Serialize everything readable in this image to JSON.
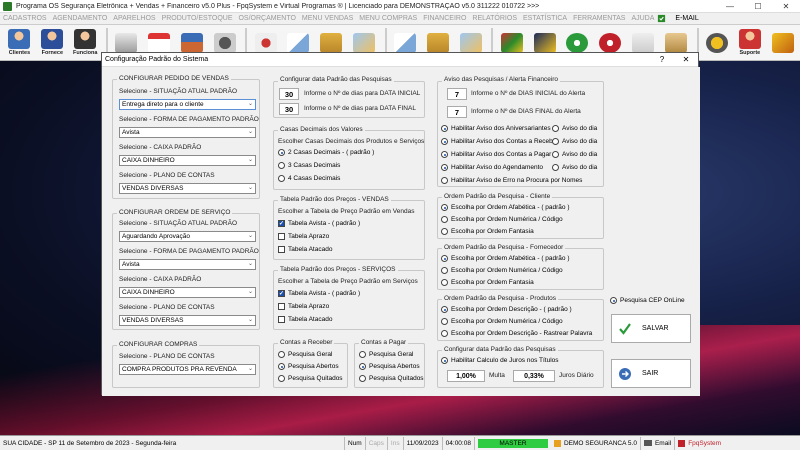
{
  "window": {
    "title": "Programa OS Segurança Eletrônica + Vendas + Financeiro v5.0 Plus - FpqSystem e Virtual Programas ® | Licenciado para  DEMONSTRAÇÃO v5.0 311222 010722 >>>"
  },
  "menu": [
    "CADASTROS",
    "AGENDAMENTO",
    "APARELHOS",
    "PRODUTO/ESTOQUE",
    "OS/ORÇAMENTO",
    "MENU VENDAS",
    "MENU COMPRAS",
    "FINANCEIRO",
    "RELATÓRIOS",
    "ESTATÍSTICA",
    "FERRAMENTAS",
    "AJUDA"
  ],
  "menu_email": "E-MAIL",
  "toolbar": {
    "clientes": "Clientes",
    "fornece": "Fornece",
    "funciona": "Funciona",
    "suporte": "Suporte"
  },
  "dialog": {
    "title": "Configuração Padrão do Sistema",
    "help": "?",
    "close": "✕",
    "pedido": {
      "legend": "CONFIGURAR PEDIDO DE VENDAS",
      "situacao_label": "Selecione - SITUAÇÃO ATUAL PADRÃO",
      "situacao_value": "Entrega direto para o cliente",
      "pagamento_label": "Selecione - FORMA DE PAGAMENTO PADRÃO",
      "pagamento_value": "Avista",
      "caixa_label": "Selecione - CAIXA PADRÃO",
      "caixa_value": "CAIXA DINHEIRO",
      "contas_label": "Selecione - PLANO DE CONTAS",
      "contas_value": "VENDAS DIVERSAS"
    },
    "os": {
      "legend": "CONFIGURAR ORDEM DE SERVIÇO",
      "situacao_label": "Selecione - SITUAÇÃO ATUAL PADRÃO",
      "situacao_value": "Aguardando Aprovação",
      "pagamento_label": "Selecione - FORMA DE PAGAMENTO PADRÃO",
      "pagamento_value": "Avista",
      "caixa_label": "Selecione - CAIXA PADRÃO",
      "caixa_value": "CAIXA DINHEIRO",
      "contas_label": "Selecione - PLANO DE CONTAS",
      "contas_value": "VENDAS DIVERSAS"
    },
    "compras": {
      "legend": "CONFIGURAR COMPRAS",
      "contas_label": "Selecione - PLANO DE CONTAS",
      "contas_value": "COMPRA PRODUTOS PRA REVENDA"
    },
    "data_pesquisa": {
      "legend": "Configurar data Padrão das Pesquisas",
      "inicial_value": "30",
      "inicial_label": "Informe o Nº de dias para DATA INICIAL",
      "final_value": "30",
      "final_label": "Informe o Nº de dias para DATA FINAL"
    },
    "decimais": {
      "legend": "Casas Decimais dos Valores",
      "subtitle": "Escolher Casas Decimais dos Produtos e Serviços",
      "options": [
        "2 Casas Decimais - ( padrão )",
        "3 Casas Decimais",
        "4 Casas Decimais"
      ]
    },
    "preco_vendas": {
      "legend": "Tabela Padrão dos Preços - VENDAS",
      "subtitle": "Escolher a Tabela de Preço Padrão em Vendas",
      "options": [
        "Tabela Avista - ( padrão )",
        "Tabela Aprazo",
        "Tabela Atacado"
      ]
    },
    "preco_servicos": {
      "legend": "Tabela Padrão dos Preços - SERVIÇOS",
      "subtitle": "Escolher a Tabela de Preço Padrão em Serviços",
      "options": [
        "Tabela Avista - ( padrão )",
        "Tabela Aprazo",
        "Tabela Atacado"
      ]
    },
    "receber": {
      "legend": "Contas a Receber",
      "options": [
        "Pesquisa Geral",
        "Pesquisa Abertos",
        "Pesquisa Quitados"
      ]
    },
    "pagar": {
      "legend": "Contas a Pagar",
      "options": [
        "Pesquisa Geral",
        "Pesquisa Abertos",
        "Pesquisa Quitados"
      ]
    },
    "aviso": {
      "legend": "Aviso das Pesquisas / Alerta Financeiro",
      "inicial_value": "7",
      "inicial_label": "Informe o Nº de DIAS INICIAL do Alerta",
      "final_value": "7",
      "final_label": "Informe o Nº de DIAS FINAL do Alerta",
      "options": [
        "Habilitar Aviso dos Aniversariantes",
        "Habilitar Aviso dos Contas a Receber",
        "Habilitar Aviso dos Contas a Pagar",
        "Habilitar Aviso do Agendamento",
        "Habilitar Aviso de Erro na Procura por Nomes"
      ],
      "dia_label": "Aviso do dia"
    },
    "ordem_cliente": {
      "legend": "Ordem Padrão da Pesquisa - Cliente",
      "options": [
        "Escolha por Ordem Afabética - ( padrão )",
        "Escolha por Ordem Numérica / Código",
        "Escolha por Ordem Fantasia"
      ]
    },
    "ordem_fornecedor": {
      "legend": "Ordem Padrão da Pesquisa - Fornecedor",
      "options": [
        "Escolha por Ordem Afabética - ( padrão )",
        "Escolha por Ordem Numérica / Código",
        "Escolha por Ordem Fantasia"
      ]
    },
    "ordem_produtos": {
      "legend": "Ordem Padrão da Pesquisa - Produtos",
      "options": [
        "Escolha por Ordem Descrição - ( padrão )",
        "Escolha por Ordem Numérica / Código",
        "Escolha por Ordem Descrição - Rastrear Palavra"
      ]
    },
    "juros": {
      "legend": "Configurar data Padrão das Pesquisas",
      "option": "Habilitar Calculo de Juros nos Títulos",
      "multa_value": "1,00%",
      "multa_label": "Multa",
      "juros_value": "0,33%",
      "juros_label": "Juros Diário"
    },
    "cep_label": "Pesquisa CEP OnLine",
    "salvar": "SALVAR",
    "sair": "SAIR"
  },
  "status": {
    "cidade": "SUA CIDADE - SP 11 de Setembro de 2023 - Segunda-feira",
    "num": "Num",
    "caps": "Caps",
    "ins": "Ins",
    "date": "11/09/2023",
    "time": "04:00:08",
    "master": "MASTER",
    "company": "DEMO SEGURANCA 5.0",
    "email": "Email",
    "brand": "FpqSystem"
  },
  "colors": {
    "accent": "#1e4fa8",
    "master_green": "#2ecc40",
    "brand_red": "#c0202a"
  }
}
